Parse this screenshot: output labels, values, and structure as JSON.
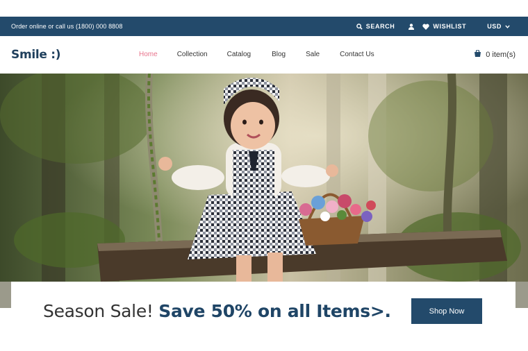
{
  "topbar": {
    "contact_text": "Order online or call us (1800) 000 8808",
    "search_label": "SEARCH",
    "wishlist_label": "WISHLIST",
    "currency_label": "USD"
  },
  "header": {
    "logo": "Smile :)",
    "nav": [
      "Home",
      "Collection",
      "Catalog",
      "Blog",
      "Sale",
      "Contact Us"
    ],
    "cart_label": "0 item(s)"
  },
  "hero": {
    "image_alt": "girl on a swing with flower basket"
  },
  "sale": {
    "lead_text": "Season Sale! ",
    "highlight_text": "Save 50% on all Items>.",
    "button_label": "Shop Now"
  },
  "colors": {
    "brand_navy": "#234a6b",
    "active_nav": "#e8748c"
  }
}
